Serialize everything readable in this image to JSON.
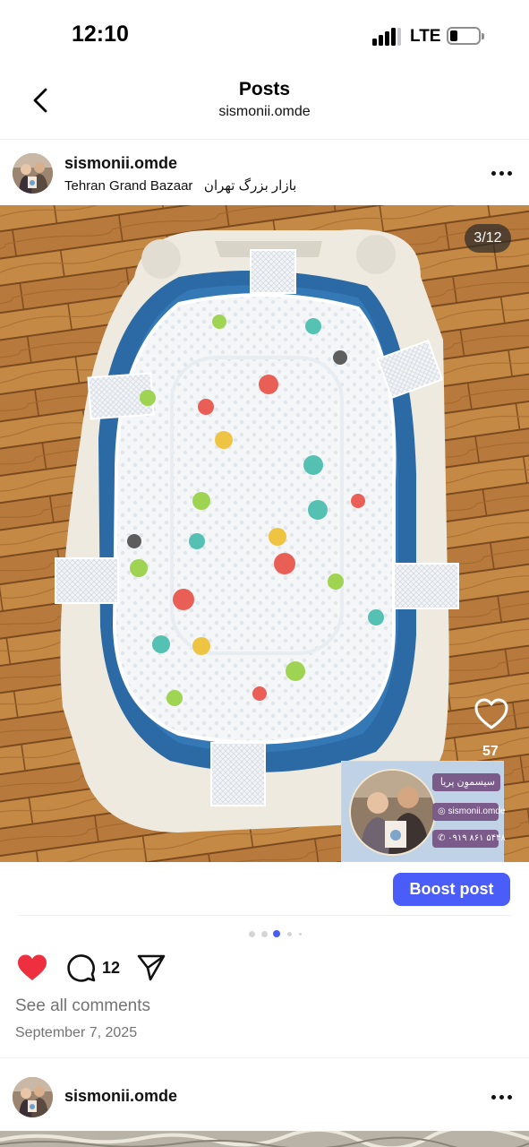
{
  "status_bar": {
    "time": "12:10",
    "network": "LTE",
    "battery_level": 0.25
  },
  "header": {
    "title": "Posts",
    "subtitle": "sismonii.omde"
  },
  "post": {
    "username": "sismonii.omde",
    "location": "Tehran Grand Bazaar   بازار بزرگ تهران",
    "media_counter": "3/12",
    "media_like_count": "57",
    "sticker": {
      "title": "سیسموِن پریا",
      "instagram": "sismonii.omde",
      "phone": "۰۹۱۹ ۸۶۱ ۵۴۴۸"
    },
    "boost_label": "Boost post",
    "pager": {
      "total": 5,
      "active": 3
    },
    "comment_count": "12",
    "see_comments": "See all comments",
    "date": "September 7, 2025",
    "liked": true,
    "like_color": "#ed2f3f"
  },
  "next_post": {
    "username": "sismonii.omde"
  },
  "colors": {
    "accent": "#4a5df9",
    "muted_text": "#737373"
  }
}
